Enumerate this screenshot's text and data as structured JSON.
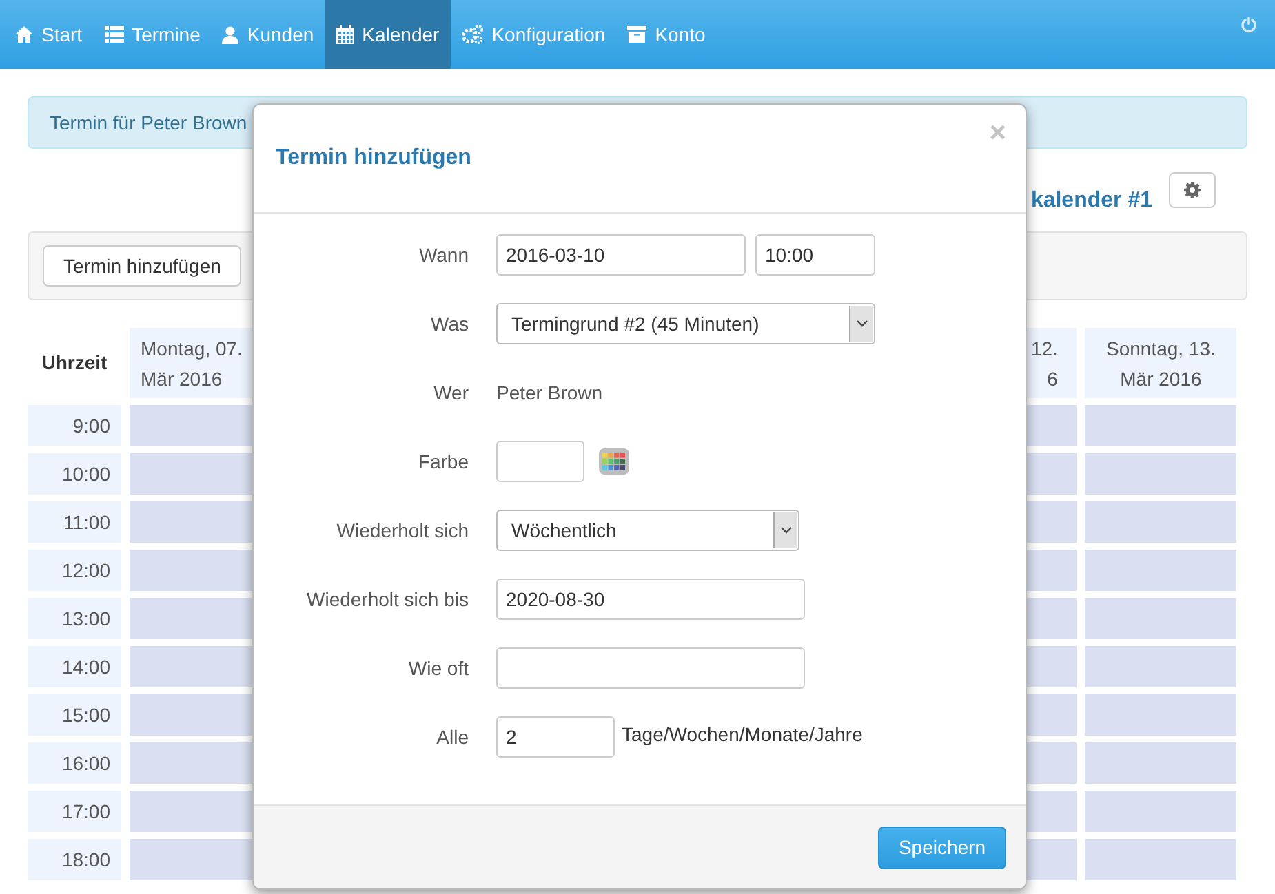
{
  "nav": {
    "items": [
      {
        "label": "Start",
        "selected": false
      },
      {
        "label": "Termine",
        "selected": false
      },
      {
        "label": "Kunden",
        "selected": false
      },
      {
        "label": "Kalender",
        "selected": true
      },
      {
        "label": "Konfiguration",
        "selected": false
      },
      {
        "label": "Konto",
        "selected": false
      }
    ]
  },
  "alert": {
    "text": "Termin für Peter Brown"
  },
  "calendar_title": "kalender #1",
  "toolbar": {
    "button": "Termin hinzufügen"
  },
  "calendar": {
    "time_header": "Uhrzeit",
    "columns": [
      {
        "kind": "cut_right",
        "line_1": "Montag, 07.",
        "line_2": "Mär 2016"
      },
      {
        "kind": "partial",
        "line_1": "12.",
        "line_2": "6"
      },
      {
        "kind": "full",
        "line_1": "Sonntag, 13.",
        "line_2": "Mär 2016"
      }
    ],
    "rows": [
      "9:00",
      "10:00",
      "11:00",
      "12:00",
      "13:00",
      "14:00",
      "15:00",
      "16:00",
      "17:00",
      "18:00"
    ]
  },
  "modal": {
    "title": "Termin hinzufügen",
    "close": "×",
    "fields": [
      {
        "kind": "datetime",
        "label": "Wann",
        "value": "2016-03-10",
        "time": "10:00"
      },
      {
        "kind": "select",
        "label": "Was",
        "value": "Termingrund #2 (45 Minuten)"
      },
      {
        "kind": "static",
        "label": "Wer",
        "value": "Peter Brown"
      },
      {
        "kind": "color",
        "label": "Farbe"
      },
      {
        "kind": "select",
        "label": "Wiederholt sich",
        "value": "Wöchentlich"
      },
      {
        "kind": "input",
        "label": "Wiederholt sich bis",
        "value": "2020-08-30"
      },
      {
        "kind": "input",
        "label": "Wie oft"
      },
      {
        "kind": "number",
        "label": "Alle",
        "value": "2",
        "suffix": "Tage/Wochen/Monate/Jahre"
      }
    ],
    "save": "Speichern"
  }
}
